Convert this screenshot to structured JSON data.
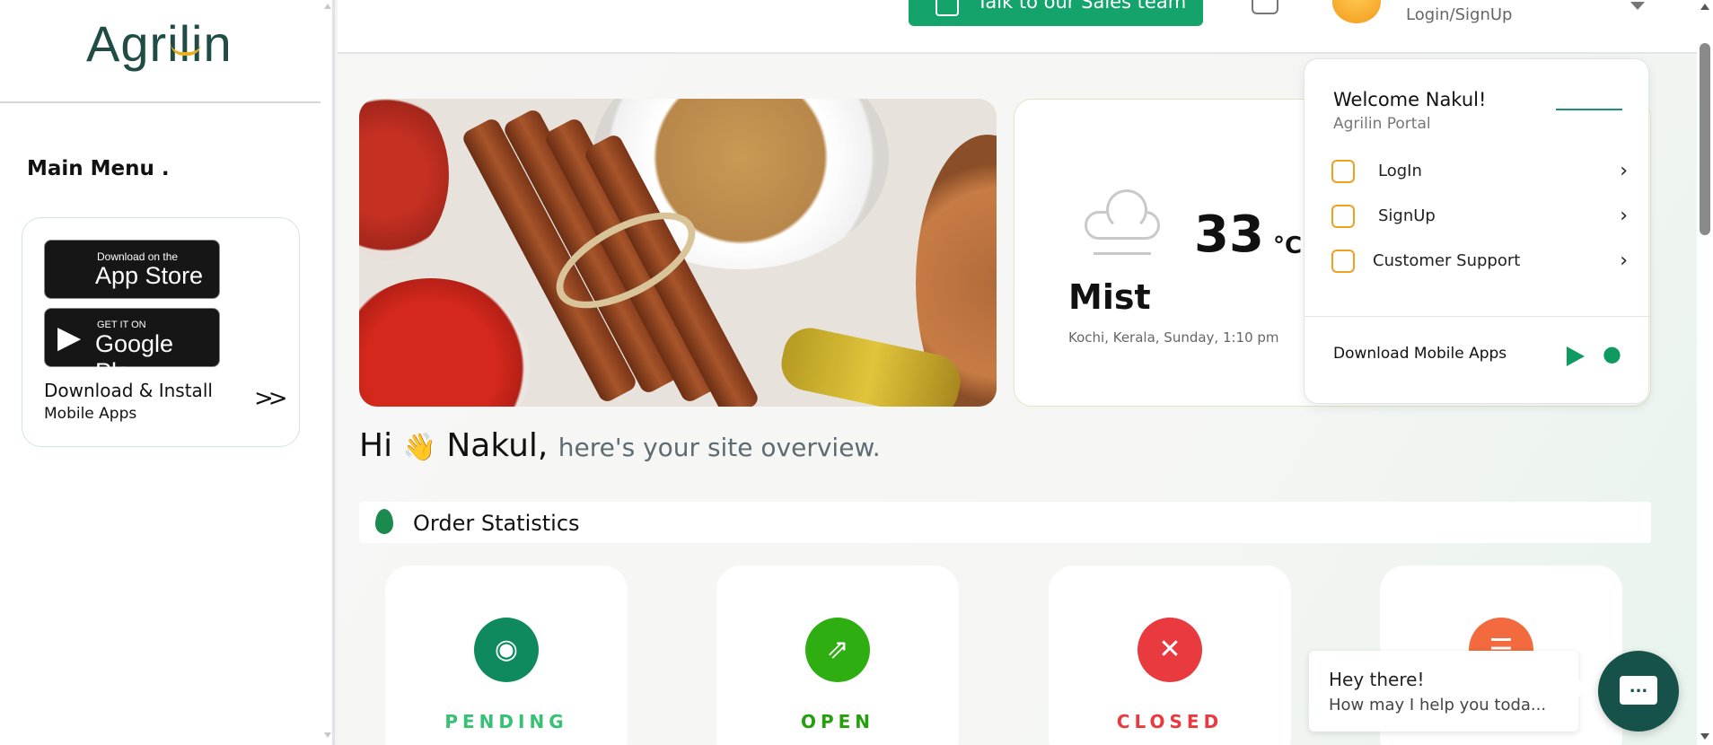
{
  "sidebar": {
    "logo": "Agrilin",
    "main_menu": "Main Menu .",
    "app_store": {
      "small": "Download on the",
      "big": "App Store"
    },
    "google_play": {
      "small": "GET IT ON",
      "big": "Google Play"
    },
    "download_title": "Download & Install",
    "download_sub": "Mobile Apps",
    "download_arrow": ">>"
  },
  "header": {
    "sales_button": "Talk to our Sales team",
    "login_link": "Login/SignUp"
  },
  "banner": {
    "alt": "spices"
  },
  "weather": {
    "temperature": "33",
    "unit": "°C",
    "condition": "Mist",
    "location": "Kochi, Kerala, Sunday, 1:10 pm"
  },
  "greeting": {
    "hi": "Hi",
    "wave": "👋",
    "name": "Nakul,",
    "sub": "here's your site overview."
  },
  "order_stats": {
    "title": "Order Statistics",
    "cards": [
      {
        "label": "PENDING",
        "icon": "eye-icon",
        "color": "#0f8a5f",
        "glyph": "◉"
      },
      {
        "label": "OPEN",
        "icon": "external-link-icon",
        "color": "#2fae12",
        "glyph": "⇗"
      },
      {
        "label": "CLOSED",
        "icon": "close-icon",
        "color": "#e83a3f",
        "glyph": "✕"
      },
      {
        "label": "",
        "icon": "message-icon",
        "color": "#f26a3d",
        "glyph": "☰"
      }
    ]
  },
  "dropdown": {
    "welcome": "Welcome Nakul!",
    "portal": "Agrilin Portal",
    "items": [
      {
        "label": "LogIn",
        "icon": "lock-icon"
      },
      {
        "label": "SignUp",
        "icon": "signup-icon"
      },
      {
        "label": "Customer Support",
        "icon": "support-icon"
      }
    ],
    "chevron": "›",
    "download": "Download Mobile Apps"
  },
  "chat": {
    "title": "Hey there!",
    "message": "How may I help you toda...",
    "button_glyph": "..."
  },
  "colors": {
    "brand_dark": "#1f4c44",
    "accent_green": "#14a36b",
    "pending": "#0f8a5f",
    "open": "#2fae12",
    "closed": "#e83a3f"
  }
}
